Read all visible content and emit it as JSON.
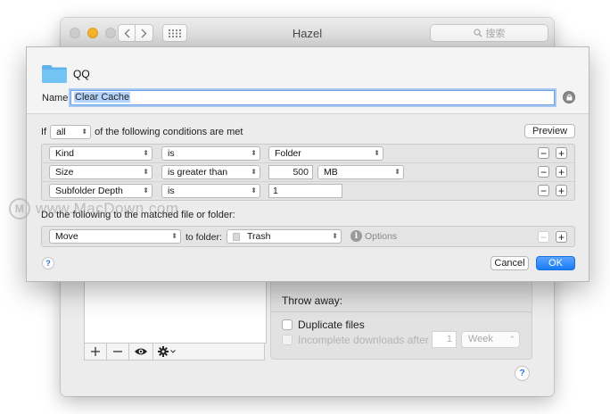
{
  "window": {
    "title": "Hazel",
    "search_placeholder": "搜索",
    "throw_away": {
      "title": "Throw away:",
      "duplicate_files": "Duplicate files",
      "incomplete_downloads": "Incomplete downloads after",
      "incomplete_count": "1",
      "unit": "Week"
    },
    "help": "?"
  },
  "sheet": {
    "folder_name": "QQ",
    "name_label": "Name:",
    "name_value": "Clear Cache",
    "if_label": "If",
    "match_value": "all",
    "conditions_suffix": "of the following conditions are met",
    "preview_label": "Preview",
    "conditions": [
      {
        "attribute": "Kind",
        "operator": "is",
        "value": "Folder"
      },
      {
        "attribute": "Size",
        "operator": "is greater than",
        "value": "500",
        "unit": "MB"
      },
      {
        "attribute": "Subfolder Depth",
        "operator": "is",
        "value": "1"
      }
    ],
    "actions_label": "Do the following to the matched file or folder:",
    "action": {
      "verb": "Move",
      "to_folder_label": "to folder:",
      "folder": "Trash",
      "options_label": "Options"
    },
    "help": "?",
    "cancel_label": "Cancel",
    "ok_label": "OK"
  },
  "watermark": "www.MacDown.com",
  "colors": {
    "accent": "#1a7cf5",
    "folder": "#6cc0f0",
    "traffic_yellow": "#f6b52e"
  }
}
